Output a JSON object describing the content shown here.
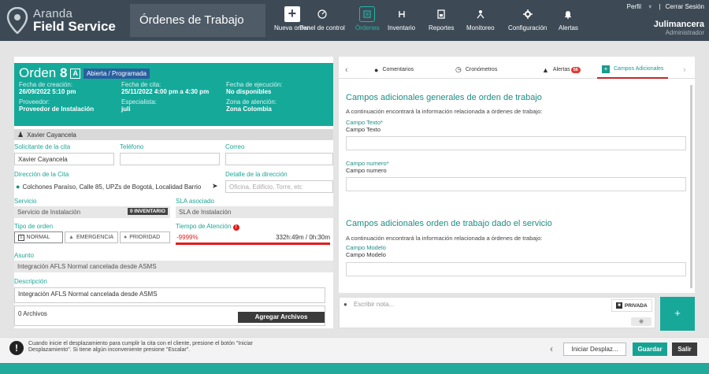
{
  "header": {
    "logo_line1": "Aranda",
    "logo_line2": "Field Service",
    "page_title": "Órdenes de Trabajo",
    "nav": [
      {
        "label": "Nueva orden",
        "icon": "plus-icon"
      },
      {
        "label": "Panel de control",
        "icon": "dashboard-icon"
      },
      {
        "label": "Órdenes",
        "icon": "orders-icon"
      },
      {
        "label": "Inventario",
        "icon": "inventory-icon"
      },
      {
        "label": "Reportes",
        "icon": "reports-icon"
      },
      {
        "label": "Monitoreo",
        "icon": "monitor-icon"
      },
      {
        "label": "Configuración",
        "icon": "gear-icon"
      },
      {
        "label": "Alertas",
        "icon": "bell-icon"
      }
    ],
    "profile_link": "Perfil",
    "logout_link": "Cerrar Sesión",
    "user_name": "Julimancera",
    "user_role": "Administrador"
  },
  "order": {
    "title_word": "Orden",
    "number": "8",
    "type_letter": "A",
    "status": "Abierta / Programada",
    "created_label": "Fecha de creación:",
    "created_value": "26/09/2022 5:10 pm",
    "appointment_label": "Fecha de cita:",
    "appointment_value": "25/11/2022 4:00 pm a 4:30 pm",
    "execution_label": "Fecha de ejecución:",
    "execution_value": "No disponibles",
    "provider_label": "Proveedor:",
    "provider_value": "Proveedor de Instalación",
    "specialist_label": "Especialista:",
    "specialist_value": "juli",
    "zone_label": "Zona de atención:",
    "zone_value": "Zona Colombia"
  },
  "contact": {
    "bar_name": "Xavier Cayancela",
    "requester_label": "Solicitante de la cita",
    "requester_value": "Xavier Cayancela",
    "phone_label": "Teléfono",
    "email_label": "Correo",
    "address_label": "Dirección de la Cita",
    "address_value": "Colchones Paraíso, Calle 85, UPZs de Bogotá, Localidad Barrio",
    "address_detail_label": "Detalle de la dirección",
    "address_detail_placeholder": "Oficina, Edificio, Torre, etc",
    "service_label": "Servicio",
    "service_value": "Servicio de Instalación",
    "inventory_badge": "0 INVENTARIO",
    "sla_label": "SLA asociado",
    "sla_value": "SLA de Instalación",
    "order_type_label": "Tipo de orden",
    "type_normal": "NORMAL",
    "type_emergency": "EMERGENCIA",
    "type_priority": "PRIORIDAD",
    "attention_label": "Tiempo de Atención",
    "attention_percent": "-9999%",
    "attention_time": "332h:49m / 0h:30m",
    "subject_label": "Asunto",
    "subject_value": "Integración AFLS Normal cancelada desde ASMS",
    "description_label": "Descripción",
    "description_value": "Integración AFLS Normal cancelada desde ASMS",
    "files_count": "0 Archivos",
    "add_files_button": "Agregar Archivos"
  },
  "tabs": {
    "comments": "Comentarios",
    "timers": "Cronómetros",
    "alerts": "Alertas",
    "alerts_badge": "56",
    "extra_fields": "Campos Adicionales"
  },
  "extra": {
    "section1_title": "Campos adicionales generales de orden de trabajo",
    "section1_desc": "A continuación encontrará la información relacionada a órdenes de trabajo:",
    "field1_label": "Campo Texto*",
    "field1_sub": "Campo Texto",
    "field2_label": "Campo numero*",
    "field2_sub": "Campo numero",
    "section2_title": "Campos adicionales orden de trabajo dado el servicio",
    "section2_desc": "A continuación encontrará la información relacionada a órdenes de trabajo:",
    "field3_label": "Campo Modelo",
    "field3_sub": "Campo Modelo"
  },
  "note": {
    "placeholder": "Escribir nota...",
    "private_label": "PRIVADA",
    "send_symbol": "+"
  },
  "footer": {
    "message": "Cuando inicie el desplazamiento para cumplir la cita con el cliente, presione el botón \"Iniciar Desplazamiento\". Si tiene algún inconveniente presione \"Escalar\".",
    "start_button": "Iniciar Desplaz...",
    "save_button": "Guardar",
    "exit_button": "Salir"
  },
  "colors": {
    "accent": "#15a99a",
    "header": "#3d4a56",
    "alert_red": "#e21c1c",
    "status_blue": "#2b5f9e"
  }
}
